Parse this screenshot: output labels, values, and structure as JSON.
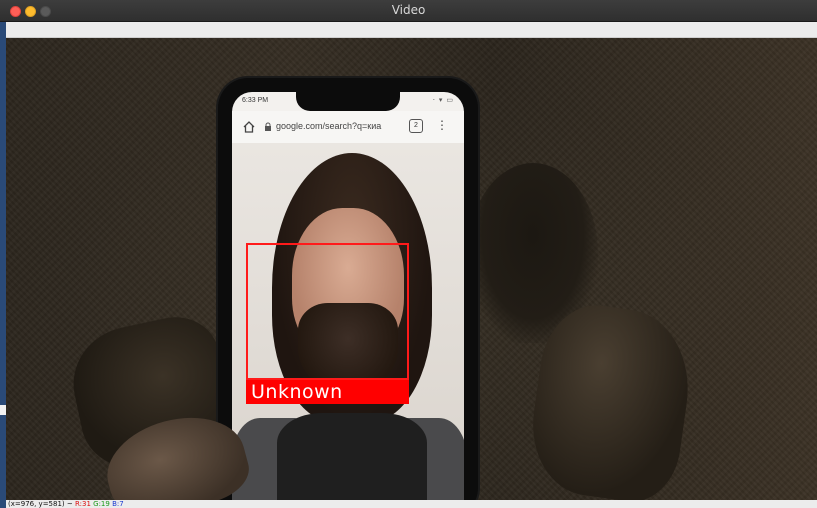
{
  "window": {
    "title": "Video",
    "traffic_lights": [
      "close",
      "minimize",
      "maximize"
    ]
  },
  "phone_screen": {
    "time": "6:33 PM",
    "url": "google.com/search?q=киа",
    "tab_count": "2",
    "icons": [
      "home-icon",
      "lock-icon",
      "kebab-menu-icon"
    ]
  },
  "detection": {
    "label": "Unknown",
    "box_color": "#ff0000",
    "label_bg": "#ff0000",
    "label_color": "#ffffff"
  },
  "statusbar": {
    "coords": "(x=976, y=581) ~",
    "r": "R:31",
    "g": "G:19",
    "b": "B:7"
  }
}
